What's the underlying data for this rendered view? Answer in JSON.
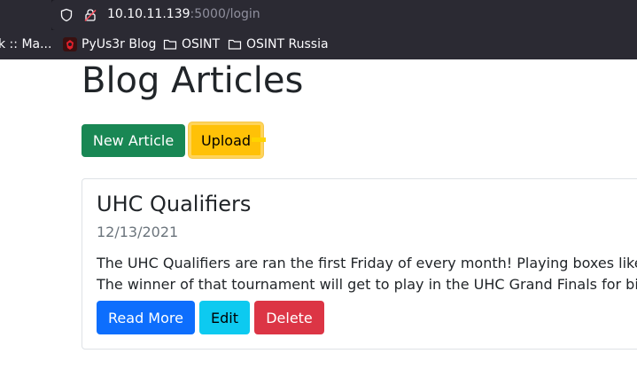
{
  "browser": {
    "tab_fragment": "k :: Ma...",
    "url_host": "10.10.11.139",
    "url_rest": ":5000/login",
    "bookmarks": [
      {
        "label": "PyUs3r Blog",
        "icon": "site-favicon"
      },
      {
        "label": "OSINT",
        "icon": "folder-icon"
      },
      {
        "label": "OSINT Russia",
        "icon": "folder-icon"
      }
    ]
  },
  "page": {
    "title": "Blog Articles",
    "new_article_label": "New Article",
    "upload_label": "Upload"
  },
  "article": {
    "title": "UHC Qualifiers",
    "date": "12/13/2021",
    "line1": "The UHC Qualifiers are ran the first Friday of every month! Playing boxes like",
    "line2": "The winner of that tournament will get to play in the UHC Grand Finals for bi",
    "read_more_label": "Read More",
    "edit_label": "Edit",
    "delete_label": "Delete"
  },
  "colors": {
    "success": "#198754",
    "warning": "#ffc107",
    "primary": "#0d6efd",
    "info": "#0dcaf0",
    "danger": "#dc3545"
  }
}
